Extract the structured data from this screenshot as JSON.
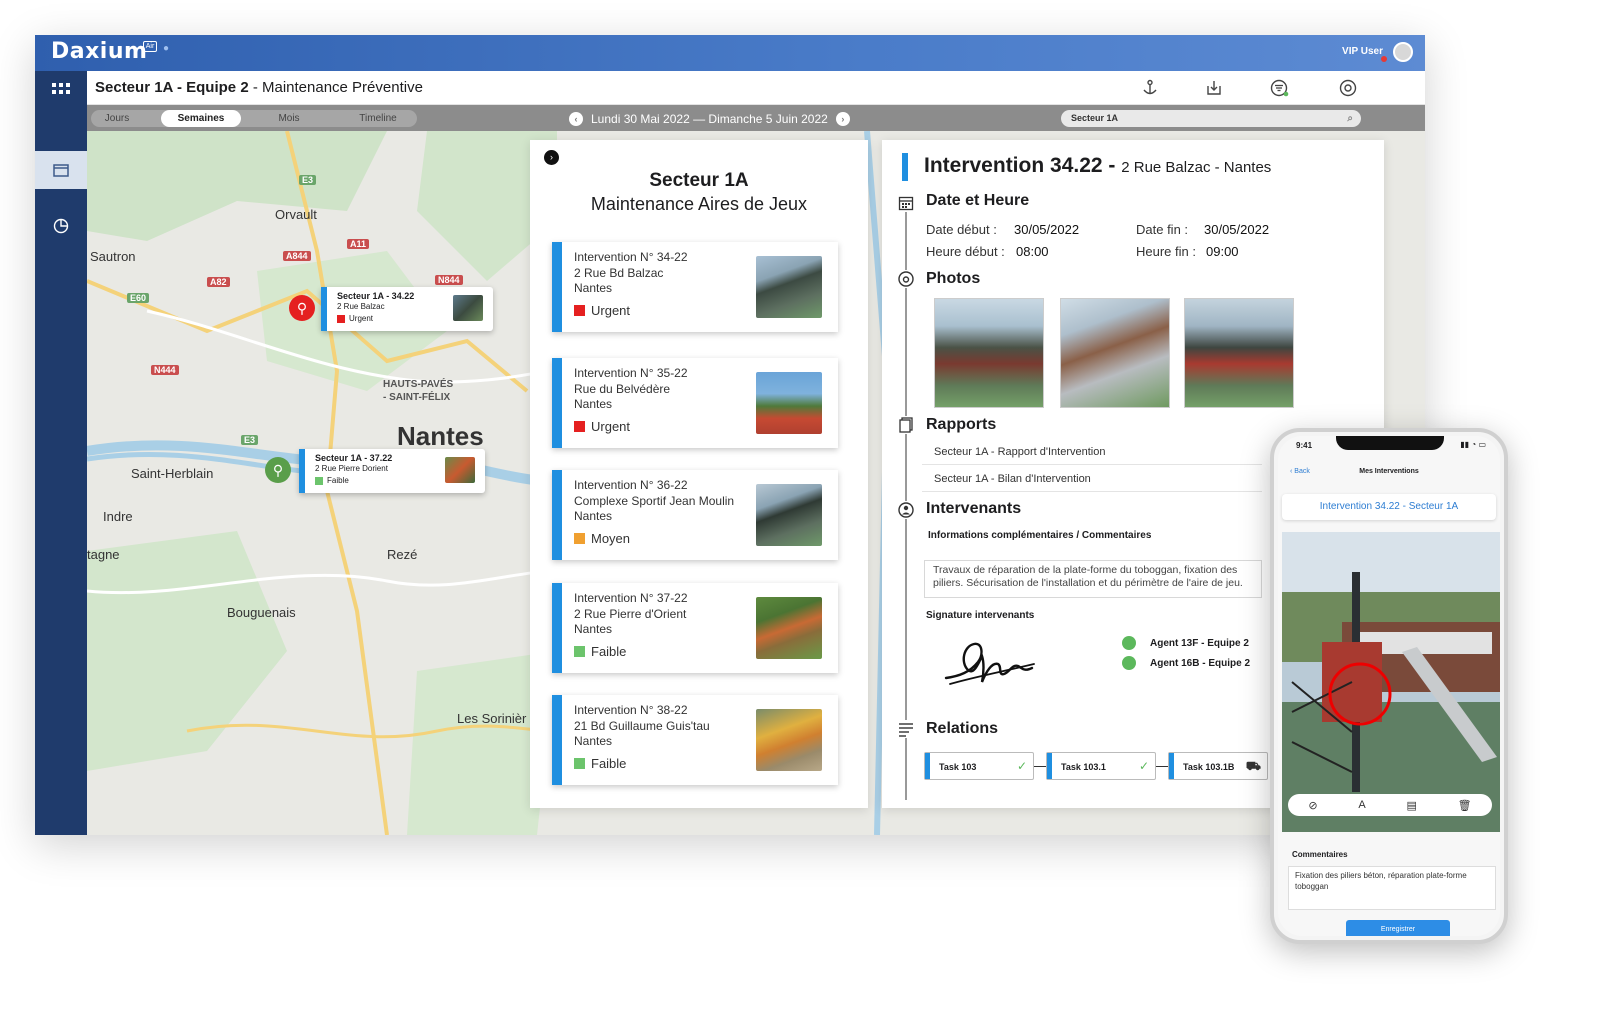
{
  "app": {
    "logo": "Daxium",
    "logo_badge": "Air",
    "user": "VIP User",
    "page_title_bold": "Secteur 1A - Equipe 2",
    "page_title_rest": " - Maintenance Préventive"
  },
  "toolbar": {
    "icons": [
      "anchor-icon",
      "download-icon",
      "filter-icon",
      "settings-icon"
    ]
  },
  "filter": {
    "tabs": [
      "Jours",
      "Semaines",
      "Mois",
      "Timeline"
    ],
    "active_tab": "Semaines",
    "date_range": "Lundi 30 Mai 2022 — Dimanche 5 Juin 2022",
    "search_value": "Secteur 1A"
  },
  "map": {
    "labels": [
      "Orvault",
      "Sautron",
      "HAUTS-PAVÉS",
      "- SAINT-FÉLIX",
      "Nantes",
      "Saint-Herblain",
      "Indre",
      "tagne",
      "Rezé",
      "Bouguenais",
      "Les Sorinièr"
    ],
    "roads": [
      "E3",
      "A11",
      "A844",
      "A82",
      "N844",
      "E60",
      "N444",
      "E3"
    ],
    "pins": [
      {
        "title": "Secteur 1A - 34.22",
        "address": "2 Rue Balzac",
        "status": "Urgent",
        "status_color": "#e52020",
        "pin_color": "#e52020"
      },
      {
        "title": "Secteur 1A - 37.22",
        "address": "2 Rue Pierre Dorient",
        "status": "Faible",
        "status_color": "#6cc46c",
        "pin_color": "#5a9e4a"
      }
    ]
  },
  "list_panel": {
    "title": "Secteur 1A",
    "subtitle": "Maintenance Aires de Jeux",
    "items": [
      {
        "id": "Intervention N° 34-22",
        "address": "2 Rue Bd Balzac",
        "city": "Nantes",
        "status": "Urgent",
        "status_color": "#e52020"
      },
      {
        "id": "Intervention N° 35-22",
        "address": "Rue du Belvédère",
        "city": "Nantes",
        "status": "Urgent",
        "status_color": "#e52020"
      },
      {
        "id": "Intervention N° 36-22",
        "address": "Complexe Sportif Jean Moulin",
        "city": "Nantes",
        "status": "Moyen",
        "status_color": "#f0a030"
      },
      {
        "id": "Intervention N° 37-22",
        "address": "2 Rue Pierre d'Orient",
        "city": "Nantes",
        "status": "Faible",
        "status_color": "#6cc46c"
      },
      {
        "id": "Intervention N° 38-22",
        "address": "21 Bd Guillaume Guis'tau",
        "city": "Nantes",
        "status": "Faible",
        "status_color": "#6cc46c"
      }
    ]
  },
  "detail": {
    "title": "Intervention 34.22",
    "title_sep": " - ",
    "title_address": "2 Rue Balzac - Nantes",
    "date_section": "Date et Heure",
    "date_debut_label": "Date début :",
    "date_debut": "30/05/2022",
    "date_fin_label": "Date fin :",
    "date_fin": "30/05/2022",
    "heure_debut_label": "Heure début :",
    "heure_debut": "08:00",
    "heure_fin_label": "Heure fin :",
    "heure_fin": "09:00",
    "photos_section": "Photos",
    "rapports_section": "Rapports",
    "rapports": [
      "Secteur 1A - Rapport d'Intervention",
      "Secteur 1A - Bilan d'Intervention"
    ],
    "intervenants_section": "Intervenants",
    "info_header": "Informations complémentaires / Commentaires",
    "comment": "Travaux de réparation de la plate-forme du toboggan, fixation des piliers. Sécurisation de l'installation et du périmètre de l'aire de jeu.",
    "signature_header": "Signature intervenants",
    "agents": [
      "Agent 13F - Equipe 2",
      "Agent 16B - Equipe 2"
    ],
    "relations_section": "Relations",
    "tasks": [
      "Task 103",
      "Task 103.1",
      "Task 103.1B"
    ]
  },
  "phone": {
    "time": "9:41",
    "back": "Back",
    "nav_title": "Mes Interventions",
    "card_title": "Intervention 34.22 - Secteur 1A",
    "comments_header": "Commentaires",
    "comment": "Fixation des piliers béton, réparation plate-forme toboggan",
    "save": "Enregistrer"
  }
}
